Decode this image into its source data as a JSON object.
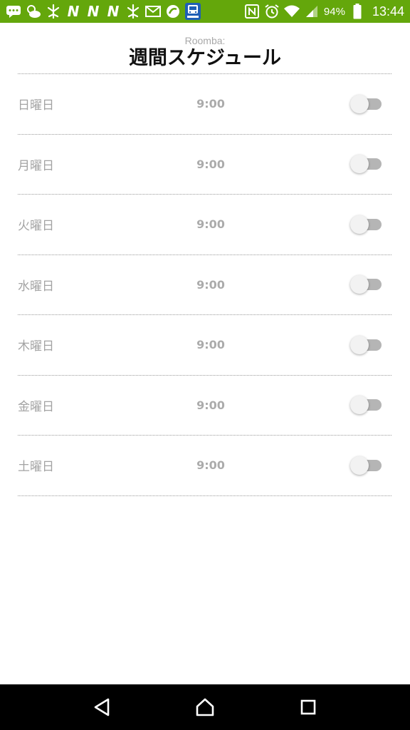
{
  "status_bar": {
    "battery_percent": "94%",
    "time": "13:44",
    "left_icons": [
      "chat-bubble-icon",
      "weather-icon",
      "leaf-icon",
      "n-app-icon",
      "n-app-icon",
      "n-app-icon",
      "leaf-icon",
      "gmail-icon",
      "hangouts-icon",
      "train-app-icon"
    ],
    "right_icons": [
      "nfc-icon",
      "alarm-icon",
      "wifi-icon",
      "cell-signal-icon",
      "battery-icon"
    ],
    "n_letter": "N",
    "color": "#64a70b"
  },
  "header": {
    "subtitle": "Roomba:",
    "title": "週間スケジュール"
  },
  "schedule": [
    {
      "day": "日曜日",
      "time": "9:00",
      "enabled": false
    },
    {
      "day": "月曜日",
      "time": "9:00",
      "enabled": false
    },
    {
      "day": "火曜日",
      "time": "9:00",
      "enabled": false
    },
    {
      "day": "水曜日",
      "time": "9:00",
      "enabled": false
    },
    {
      "day": "木曜日",
      "time": "9:00",
      "enabled": false
    },
    {
      "day": "金曜日",
      "time": "9:00",
      "enabled": false
    },
    {
      "day": "土曜日",
      "time": "9:00",
      "enabled": false
    }
  ],
  "nav_bar": {
    "buttons": [
      "back-icon",
      "home-icon",
      "recents-icon"
    ]
  }
}
